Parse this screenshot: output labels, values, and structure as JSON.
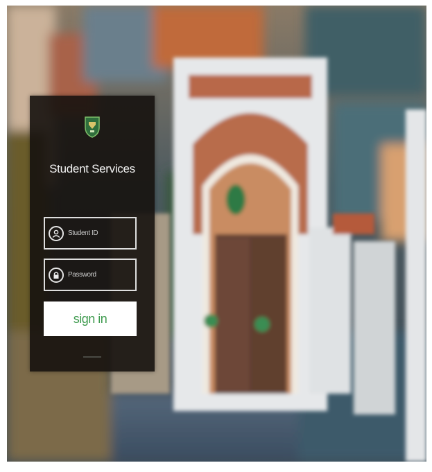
{
  "portal": {
    "title": "Student Services",
    "logo_icon": "shield-crest-icon",
    "brand_color": "#3e9a4e"
  },
  "form": {
    "student_id": {
      "placeholder": "Student ID",
      "value": "",
      "icon": "user-icon"
    },
    "password": {
      "placeholder": "Password",
      "value": "",
      "icon": "lock-icon"
    },
    "submit_label": "sign in"
  }
}
